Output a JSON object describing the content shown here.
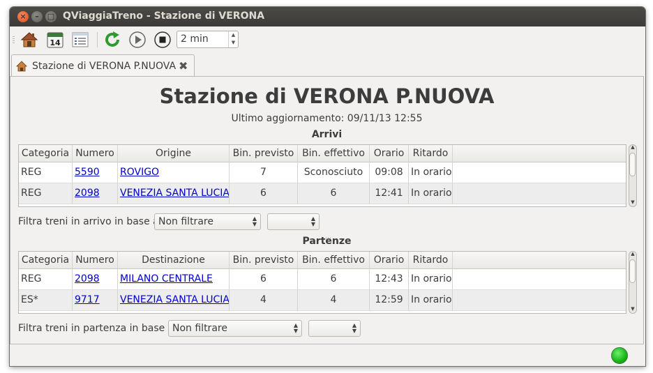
{
  "window": {
    "title": "QViaggiaTreno - Stazione di VERONA",
    "buttons": {
      "close": "×",
      "minimize": "–",
      "maximize": "□"
    }
  },
  "toolbar": {
    "icons": [
      "home-icon",
      "calendar-icon",
      "list-icon",
      "refresh-icon",
      "play-icon",
      "stop-icon"
    ],
    "calendar_day": "14",
    "interval_value": "2 min"
  },
  "tab": {
    "label": "Stazione di VERONA P.NUOVA",
    "close": "✖"
  },
  "page": {
    "title": "Stazione di VERONA P.NUOVA",
    "last_update": "Ultimo aggiornamento: 09/11/13 12:55"
  },
  "arrivals": {
    "section_title": "Arrivi",
    "columns": [
      "Categoria",
      "Numero",
      "Origine",
      "Bin. previsto",
      "Bin. effettivo",
      "Orario",
      "Ritardo"
    ],
    "rows": [
      {
        "categoria": "REG",
        "numero": "5590",
        "luogo": "ROVIGO",
        "bin_previsto": "7",
        "bin_effettivo": "Sconosciuto",
        "orario": "09:08",
        "ritardo": "In orario"
      },
      {
        "categoria": "REG",
        "numero": "2098",
        "luogo": "VENEZIA SANTA LUCIA",
        "bin_previsto": "6",
        "bin_effettivo": "6",
        "orario": "12:41",
        "ritardo": "In orario"
      }
    ],
    "filter_label": "Filtra treni in arrivo in base a",
    "filter_value": "Non filtrare",
    "filter_value2": ""
  },
  "departures": {
    "section_title": "Partenze",
    "columns": [
      "Categoria",
      "Numero",
      "Destinazione",
      "Bin. previsto",
      "Bin. effettivo",
      "Orario",
      "Ritardo"
    ],
    "rows": [
      {
        "categoria": "REG",
        "numero": "2098",
        "luogo": "MILANO CENTRALE",
        "bin_previsto": "6",
        "bin_effettivo": "6",
        "orario": "12:43",
        "ritardo": "In orario"
      },
      {
        "categoria": "ES*",
        "numero": "9717",
        "luogo": "VENEZIA SANTA LUCIA",
        "bin_previsto": "4",
        "bin_effettivo": "4",
        "orario": "12:59",
        "ritardo": "In orario"
      }
    ],
    "filter_label": "Filtra treni in partenza in base a",
    "filter_value": "Non filtrare",
    "filter_value2": ""
  },
  "status": {
    "indicator_color": "#17b417"
  }
}
